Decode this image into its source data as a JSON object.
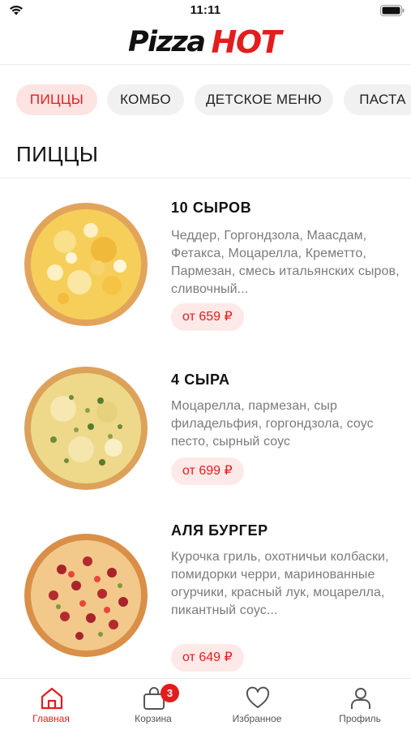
{
  "status_bar": {
    "time": "11:11"
  },
  "header": {
    "logo_part1": "Pizza",
    "logo_part2": "HOT"
  },
  "categories": [
    {
      "label": "ПИЦЦЫ",
      "active": true
    },
    {
      "label": "КОМБО",
      "active": false
    },
    {
      "label": "ДЕТСКОЕ МЕНЮ",
      "active": false
    },
    {
      "label": "ПАСТА",
      "active": false
    }
  ],
  "section": {
    "title": "ПИЦЦЫ"
  },
  "products": [
    {
      "name": "10 СЫРОВ",
      "description": "Чеддер, Горгондзола, Маасдам, Фетакса, Моцарелла, Креметто, Пармезан, смесь итальянских сыров, сливочный...",
      "price": "от 659 ₽",
      "image": "pizza-10-cheese"
    },
    {
      "name": "4 СЫРА",
      "description": "Моцарелла, пармезан, сыр филадельфия, горгондзола, соус песто, сырный соус",
      "price": "от 699 ₽",
      "image": "pizza-4-cheese"
    },
    {
      "name": "АЛЯ БУРГЕР",
      "description": "Курочка гриль, охотничьи колбаски, помидорки черри, маринованные огурчики, красный лук, моцарелла, пикантный соус...",
      "price": "от 649 ₽",
      "image": "pizza-burger"
    }
  ],
  "tab_bar": {
    "home": "Главная",
    "cart": "Корзина",
    "cart_badge": "3",
    "favorites": "Избранное",
    "profile": "Профиль"
  },
  "colors": {
    "accent": "#e21d1d",
    "accent_soft": "#fde3e1",
    "chip_bg": "#f1f1f1",
    "muted_text": "#7b7b7b"
  },
  "icons": [
    "wifi-icon",
    "battery-icon",
    "home-icon",
    "bag-icon",
    "heart-icon",
    "person-icon"
  ]
}
